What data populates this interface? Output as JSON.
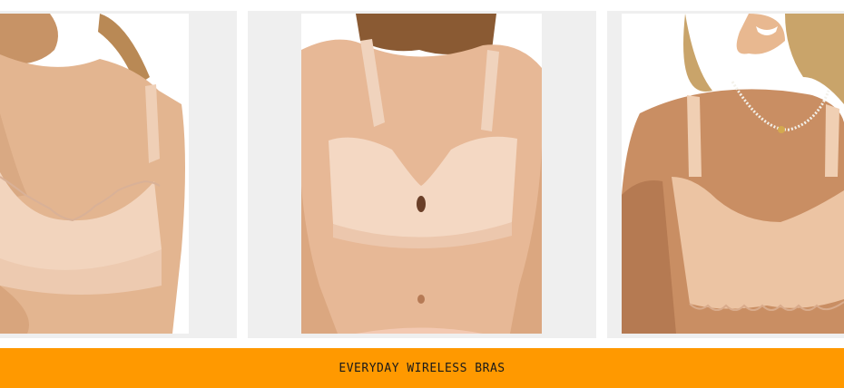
{
  "products": [
    {
      "icon": "product-photo-scalloped-wireless-bra",
      "image_alt": "Model wearing nude scalloped-edge wireless bra"
    },
    {
      "icon": "product-photo-keyhole-wireless-bra",
      "image_alt": "Model wearing nude keyhole wireless bra"
    },
    {
      "icon": "product-photo-scalloped-bralette",
      "image_alt": "Model wearing nude scalloped wireless bralette with pearl necklace"
    }
  ],
  "banner": {
    "label": "EVERYDAY WIRELESS BRAS",
    "color": "#ff9900"
  },
  "colors": {
    "tile_background": "#efefef",
    "skin": "#e7b896",
    "fabric": "#f3d3bd",
    "hair": "#9a6a3e"
  }
}
